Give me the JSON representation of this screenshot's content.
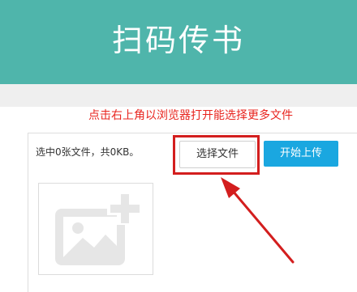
{
  "header": {
    "title": "扫码传书"
  },
  "hint": {
    "text": "点击右上角以浏览器打开能选择更多文件"
  },
  "uploader": {
    "status": "选中0张文件，共0KB。",
    "choose_label": "选择文件",
    "upload_label": "开始上传",
    "placeholder_icon": "add-image-icon"
  },
  "colors": {
    "header_bg": "#4fb5ab",
    "hint_text": "#e8251f",
    "annotation": "#d31e1e",
    "upload_btn": "#1aa7e0"
  }
}
